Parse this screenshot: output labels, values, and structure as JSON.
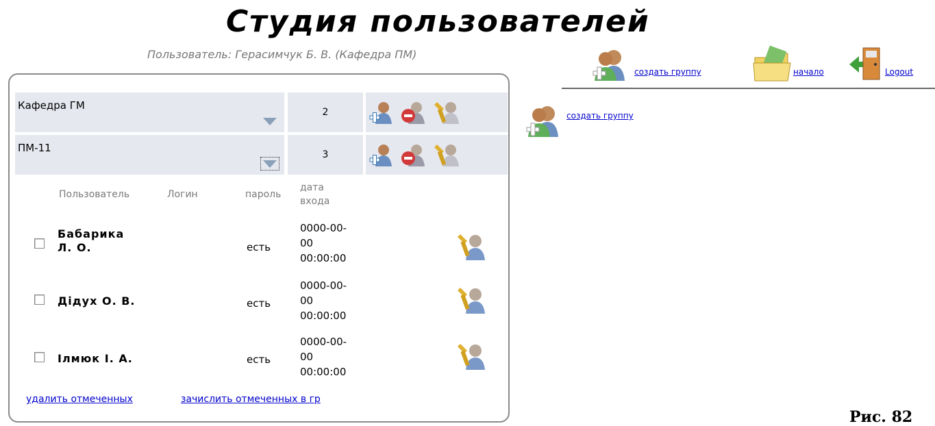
{
  "header": {
    "title": "Студия пользователей",
    "user_line": "Пользователь: Герасимчук Б. В. (Кафедра ПМ)"
  },
  "top_nav": {
    "create_group": "создать группу",
    "home": "начало",
    "logout": "Logout"
  },
  "groups": [
    {
      "name": "Кафедра ГМ",
      "count": "2"
    },
    {
      "name": "ПМ-11",
      "count": "3"
    }
  ],
  "table_headers": {
    "user": "Пользователь",
    "login": "Логин",
    "password": "пароль",
    "date": "дата\nвхода"
  },
  "users": [
    {
      "name": "Бабарика\nЛ. О.",
      "password": "есть",
      "date": "0000-00-\n00\n00:00:00"
    },
    {
      "name": "Дідух О. В.",
      "password": "есть",
      "date": "0000-00-\n00\n00:00:00"
    },
    {
      "name": "Ілмюк І. А.",
      "password": "есть",
      "date": "0000-00-\n00\n00:00:00"
    }
  ],
  "actions": {
    "delete_selected": "удалить отмеченных",
    "enroll_selected": "зачислить отмеченных в гр"
  },
  "side": {
    "create_group": "создать группу"
  },
  "figure_caption": "Рис. 82"
}
